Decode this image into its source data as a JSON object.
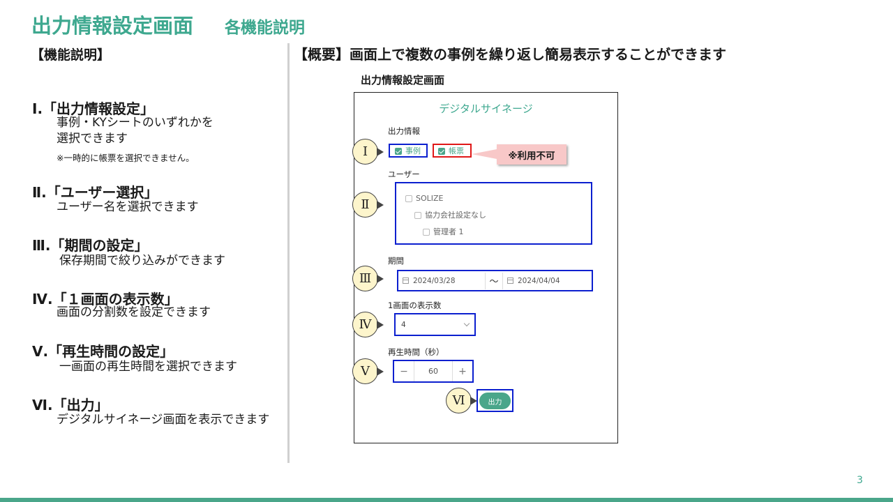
{
  "header": {
    "title": "出力情報設定画面",
    "subtitle": "各機能説明"
  },
  "left": {
    "heading": "【機能説明】",
    "features": [
      {
        "title": "Ⅰ.「出力情報設定」",
        "desc": [
          "事例・KYシートのいずれかを",
          "選択できます"
        ],
        "note": "※一時的に帳票を選択できません。"
      },
      {
        "title": "Ⅱ.「ユーザー選択」",
        "desc": [
          "ユーザー名を選択できます"
        ]
      },
      {
        "title": "Ⅲ.「期間の設定」",
        "desc": [
          "保存期間で絞り込みができます"
        ]
      },
      {
        "title": "Ⅳ.「１画面の表示数」",
        "desc": [
          "画面の分割数を設定できます"
        ]
      },
      {
        "title": "Ⅴ.「再生時間の設定」",
        "desc": [
          "一画面の再生時間を選択できます"
        ]
      },
      {
        "title": "Ⅵ.「出力」",
        "desc": [
          "デジタルサイネージ画面を表示できます"
        ]
      }
    ]
  },
  "right": {
    "overview": "【概要】画面上で複数の事例を繰り返し簡易表示することができます",
    "screen_label": "出力情報設定画面",
    "mock": {
      "title": "デジタルサイネージ",
      "output_info_label": "出力情報",
      "opt_jirei": "事例",
      "opt_chohyo": "帳票",
      "unavailable_note": "※利用不可",
      "user_label": "ユーザー",
      "users": [
        "SOLIZE",
        "協力会社設定なし",
        "管理者 1"
      ],
      "period_label": "期間",
      "date_from": "2024/03/28",
      "date_sep": "〜",
      "date_to": "2024/04/04",
      "display_count_label": "1画面の表示数",
      "display_count_value": "4",
      "playtime_label": "再生時間（秒）",
      "playtime_minus": "−",
      "playtime_value": "60",
      "playtime_plus": "+",
      "output_button": "出力"
    },
    "callouts": [
      "Ⅰ",
      "Ⅱ",
      "Ⅲ",
      "Ⅳ",
      "Ⅴ",
      "Ⅵ"
    ]
  },
  "footer": {
    "page_number": "3"
  },
  "colors": {
    "accent": "#3ea88f",
    "highlight_blue": "#0b1fcf",
    "highlight_red": "#e01818",
    "callout_fill": "#fdf5cc"
  }
}
